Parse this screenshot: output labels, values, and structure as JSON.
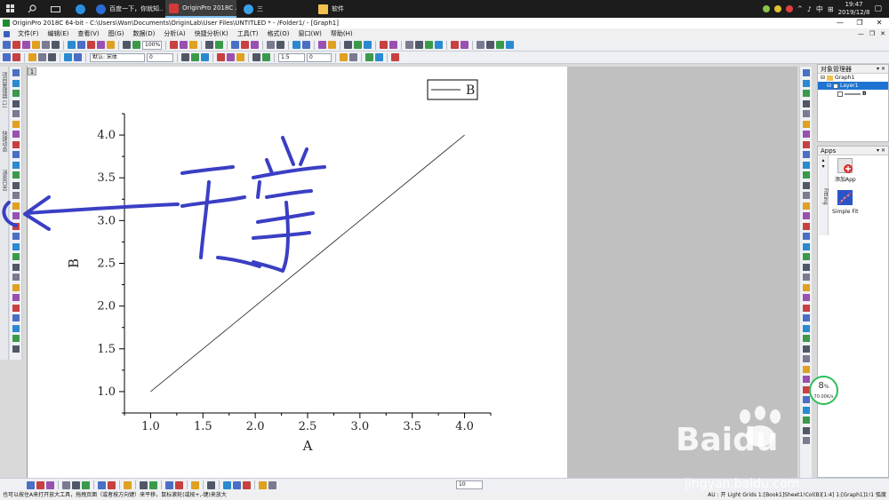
{
  "taskbar": {
    "apps": [
      {
        "label": "百度一下，你就知..."
      },
      {
        "label": "OriginPro 2018C ..."
      },
      {
        "label": "三"
      },
      {
        "label": "软件"
      }
    ],
    "tray_lang": "中",
    "clock_time": "19:47",
    "clock_date": "2019/12/8"
  },
  "titlebar": {
    "title": "OriginPro 2018C 64-bit - C:\\Users\\Wan\\Documents\\OriginLab\\User Files\\UNTITLED * - /Folder1/ - [Graph1]"
  },
  "menu": {
    "items": [
      "文件(F)",
      "编辑(E)",
      "查看(V)",
      "图(G)",
      "数据(D)",
      "分析(A)",
      "快捷分析(K)",
      "工具(T)",
      "格式(O)",
      "窗口(W)",
      "帮助(H)"
    ]
  },
  "toolbar": {
    "zoom": "100%",
    "font_name": "默认: 宋体",
    "font_size": "0",
    "line_width": "1.5",
    "fill_value": "0",
    "bottom_select": "10"
  },
  "left_tabs": [
    "项目管理器 (1)",
    "快捷动态",
    "消息日志"
  ],
  "window_number": "1",
  "chart_data": {
    "type": "line",
    "series": [
      {
        "name": "B",
        "x": [
          1.0,
          4.0
        ],
        "y": [
          1.0,
          4.0
        ]
      }
    ],
    "xlabel": "A",
    "ylabel": "B",
    "xlim": [
      0.75,
      4.25
    ],
    "ylim": [
      0.75,
      4.25
    ],
    "xticks": [
      "1.0",
      "1.5",
      "2.0",
      "2.5",
      "3.0",
      "3.5",
      "4.0"
    ],
    "yticks": [
      "1.0",
      "1.5",
      "2.0",
      "2.5",
      "3.0",
      "3.5",
      "4.0"
    ],
    "legend_position": "top-right",
    "grid": false
  },
  "object_manager": {
    "title": "对象管理器",
    "graph": "Graph1",
    "layer": "Layer1",
    "plot": "B"
  },
  "apps": {
    "title": "Apps",
    "tab_label": "Fitting",
    "add_app": "添加App",
    "simple_fit": "Simple Fit"
  },
  "speed_widget": {
    "percent": "8",
    "unit": "%",
    "rate": "70.00K/s"
  },
  "statusbar": {
    "left": "也可以按住A来打开放大工具，拖拽页面（或者按方向键）来平移，鼠标滚轮(或按+,-键)来放大",
    "right": "AU : 开  Light Grids  1:[Book1]Sheet1!Col(B)[1:4]  1:[Graph1]1!1  弧度"
  },
  "watermark": {
    "logo": "Baidu",
    "name": "经验",
    "url": "jingyan.baidu.com"
  },
  "colors": {
    "ink": "#3a3fc4",
    "plot_line": "#222222",
    "selection": "#1e73d2",
    "accent_green": "#2bbf5a"
  }
}
